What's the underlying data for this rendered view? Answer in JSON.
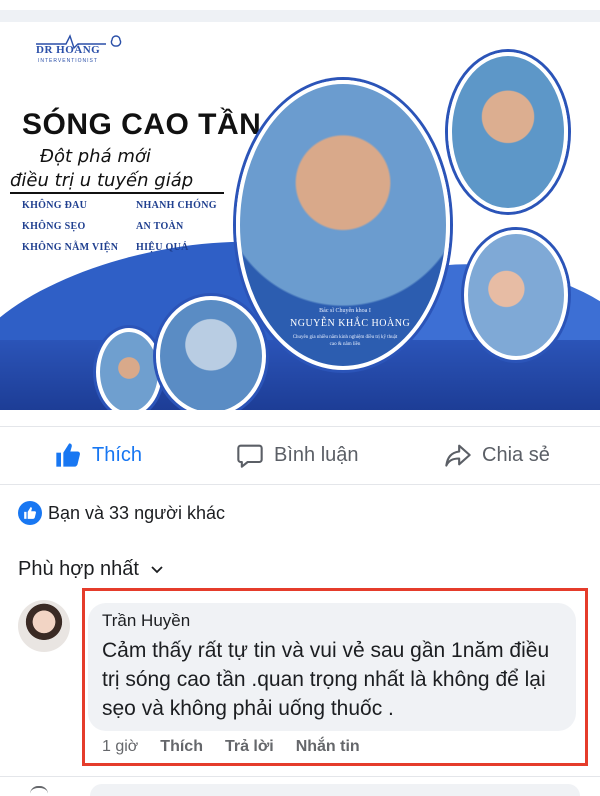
{
  "post_image": {
    "logo_title": "DR HOÀNG",
    "logo_subtitle": "INTERVENTIONIST",
    "headline": "SÓNG CAO TẦN",
    "subline1": "Đột phá mới",
    "subline2": "điều trị u tuyến giáp",
    "features": [
      "KHÔNG ĐAU",
      "KHÔNG SẸO",
      "KHÔNG NẰM VIỆN",
      "NHANH CHÓNG",
      "AN TOÀN",
      "HIỆU QUẢ"
    ],
    "doctor_title": "Bác sĩ Chuyên khoa I",
    "doctor_name": "NGUYỄN KHẮC HOÀNG",
    "doctor_desc": "Chuyên gia nhiều năm kinh nghiệm điều trị kỹ thuật cao & nâm liền",
    "colors": {
      "brand_blue": "#2b54b8"
    }
  },
  "actions": {
    "like_label": "Thích",
    "comment_label": "Bình luận",
    "share_label": "Chia sẻ",
    "like_color": "#1877f2"
  },
  "reactions": {
    "text": "Bạn và 33 người khác"
  },
  "sort": {
    "label": "Phù hợp nhất"
  },
  "comment": {
    "author": "Trần Huyền",
    "text": "Cảm thấy rất tự tin và vui vẻ sau gần 1năm điều trị sóng cao tần .quan trọng nhất là không để lại sẹo và không phải uống thuốc .",
    "time": "1 giờ",
    "like_label": "Thích",
    "reply_label": "Trả lời",
    "message_label": "Nhắn tin",
    "highlight_color": "#e53c2b"
  }
}
